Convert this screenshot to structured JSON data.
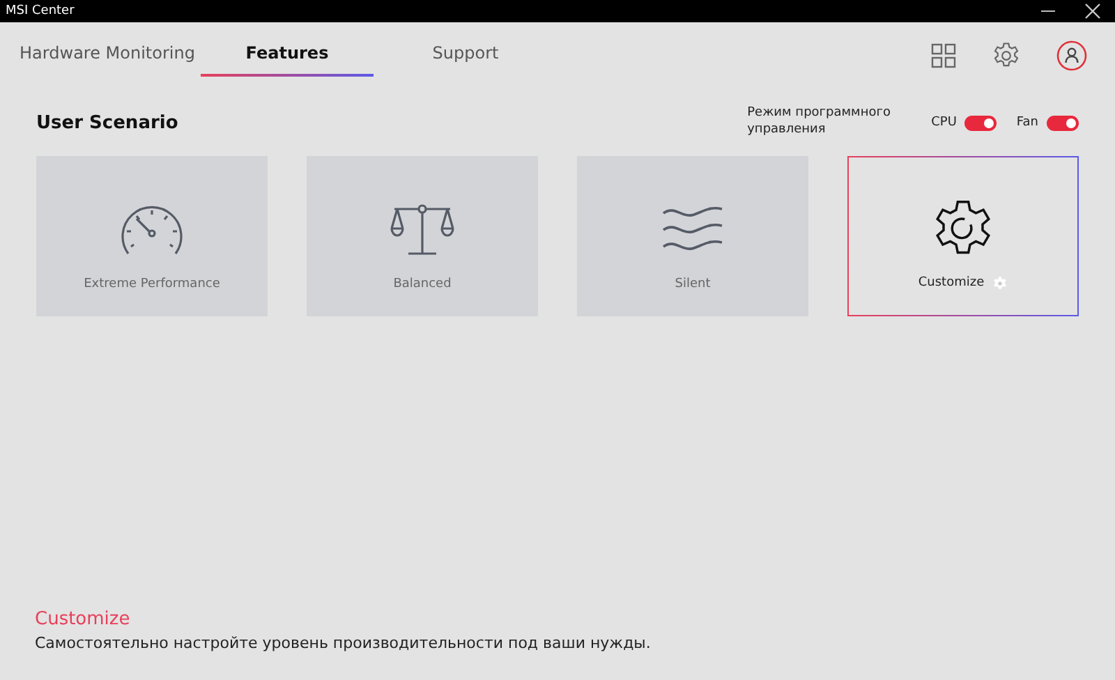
{
  "window": {
    "title": "MSI Center"
  },
  "tabs": [
    {
      "label": "Hardware Monitoring",
      "selected": false
    },
    {
      "label": "Features",
      "selected": true
    },
    {
      "label": "Support",
      "selected": false
    }
  ],
  "section": {
    "title": "User Scenario",
    "mode_label": "Режим программного управления"
  },
  "toggles": [
    {
      "label": "CPU",
      "on": true
    },
    {
      "label": "Fan",
      "on": true
    }
  ],
  "scenarios": [
    {
      "label": "Extreme Performance",
      "kind": "gauge",
      "selected": false
    },
    {
      "label": "Balanced",
      "kind": "scale",
      "selected": false
    },
    {
      "label": "Silent",
      "kind": "waves",
      "selected": false
    },
    {
      "label": "Customize",
      "kind": "gear",
      "selected": true,
      "settings": true
    }
  ],
  "description": {
    "title": "Customize",
    "text": "Самостоятельно настройте уровень производительности под ваши нужды."
  }
}
